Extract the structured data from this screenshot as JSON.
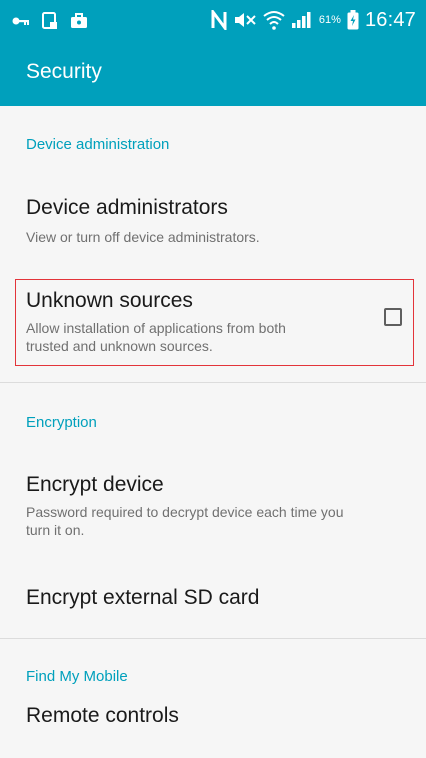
{
  "status_bar": {
    "icons_left": [
      "key-icon",
      "screenshot-icon",
      "briefcase-icon"
    ],
    "icons_right": [
      "nfc-icon",
      "mute-icon",
      "wifi-icon",
      "signal-icon",
      "battery-icon"
    ],
    "battery_percent": "61%",
    "time": "16:47"
  },
  "app_bar": {
    "title": "Security"
  },
  "sections": {
    "device_administration": {
      "header": "Device administration",
      "device_administrators": {
        "title": "Device administrators",
        "subtitle": "View or turn off device administrators."
      },
      "unknown_sources": {
        "title": "Unknown sources",
        "subtitle_line1": "Allow installation of applications from both",
        "subtitle_line2": "trusted and unknown sources.",
        "checked": false
      }
    },
    "encryption": {
      "header": "Encryption",
      "encrypt_device": {
        "title": "Encrypt device",
        "subtitle_line1": "Password required to decrypt device each time you",
        "subtitle_line2": "turn it on."
      },
      "encrypt_sd": {
        "title": "Encrypt external SD card"
      }
    },
    "find_my_mobile": {
      "header": "Find My Mobile",
      "remote_controls": {
        "title": "Remote controls"
      }
    }
  },
  "colors": {
    "accent": "#00a0bc",
    "highlight": "#e3343a",
    "background": "#f6f6f6"
  }
}
